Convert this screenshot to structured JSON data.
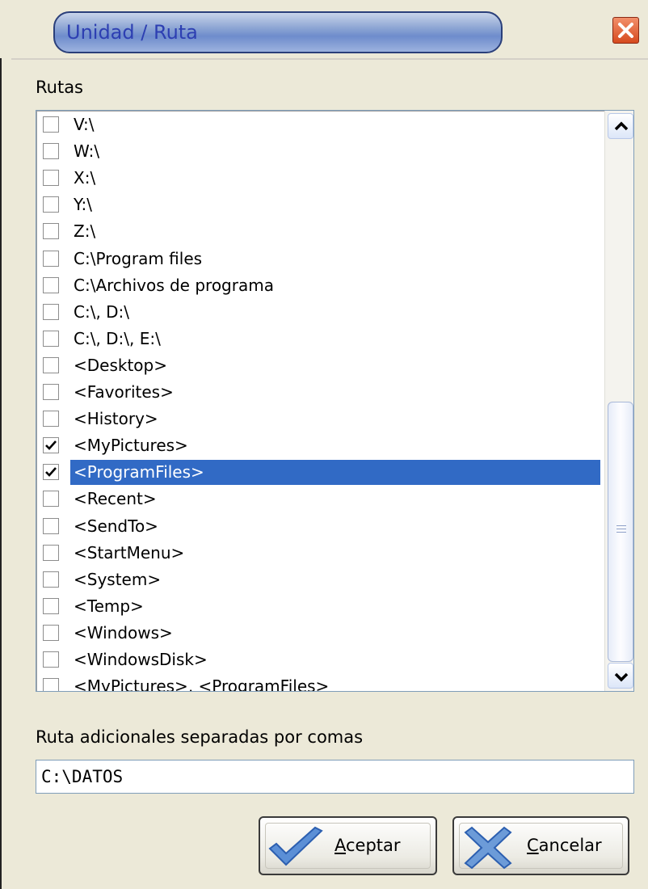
{
  "window": {
    "title": "Unidad / Ruta"
  },
  "rutas_label": "Rutas",
  "items": [
    {
      "label": "V:\\",
      "checked": false,
      "selected": false
    },
    {
      "label": "W:\\",
      "checked": false,
      "selected": false
    },
    {
      "label": "X:\\",
      "checked": false,
      "selected": false
    },
    {
      "label": "Y:\\",
      "checked": false,
      "selected": false
    },
    {
      "label": "Z:\\",
      "checked": false,
      "selected": false
    },
    {
      "label": "C:\\Program files",
      "checked": false,
      "selected": false
    },
    {
      "label": "C:\\Archivos de programa",
      "checked": false,
      "selected": false
    },
    {
      "label": "C:\\, D:\\",
      "checked": false,
      "selected": false
    },
    {
      "label": "C:\\, D:\\, E:\\",
      "checked": false,
      "selected": false
    },
    {
      "label": "<Desktop>",
      "checked": false,
      "selected": false
    },
    {
      "label": "<Favorites>",
      "checked": false,
      "selected": false
    },
    {
      "label": "<History>",
      "checked": false,
      "selected": false
    },
    {
      "label": "<MyPictures>",
      "checked": true,
      "selected": false
    },
    {
      "label": "<ProgramFiles>",
      "checked": true,
      "selected": true
    },
    {
      "label": "<Recent>",
      "checked": false,
      "selected": false
    },
    {
      "label": "<SendTo>",
      "checked": false,
      "selected": false
    },
    {
      "label": "<StartMenu>",
      "checked": false,
      "selected": false
    },
    {
      "label": "<System>",
      "checked": false,
      "selected": false
    },
    {
      "label": "<Temp>",
      "checked": false,
      "selected": false
    },
    {
      "label": "<Windows>",
      "checked": false,
      "selected": false
    },
    {
      "label": "<WindowsDisk>",
      "checked": false,
      "selected": false
    },
    {
      "label": "<MyPictures>, <ProgramFiles>",
      "checked": false,
      "selected": false
    }
  ],
  "additional_label": "Ruta adicionales separadas por comas",
  "additional_value": "C:\\DATOS",
  "buttons": {
    "accept_first": "A",
    "accept_rest": "ceptar",
    "cancel_first": "C",
    "cancel_rest": "ancelar"
  },
  "colors": {
    "selection": "#316ac5",
    "accept_icon": "#5b8fd6",
    "cancel_icon": "#6c9bd8",
    "close": "#e0552a"
  },
  "icons": {
    "close": "close-icon",
    "accept": "checkmark-icon",
    "cancel": "x-icon",
    "scroll_up": "chevron-up-icon",
    "scroll_down": "chevron-down-icon"
  }
}
